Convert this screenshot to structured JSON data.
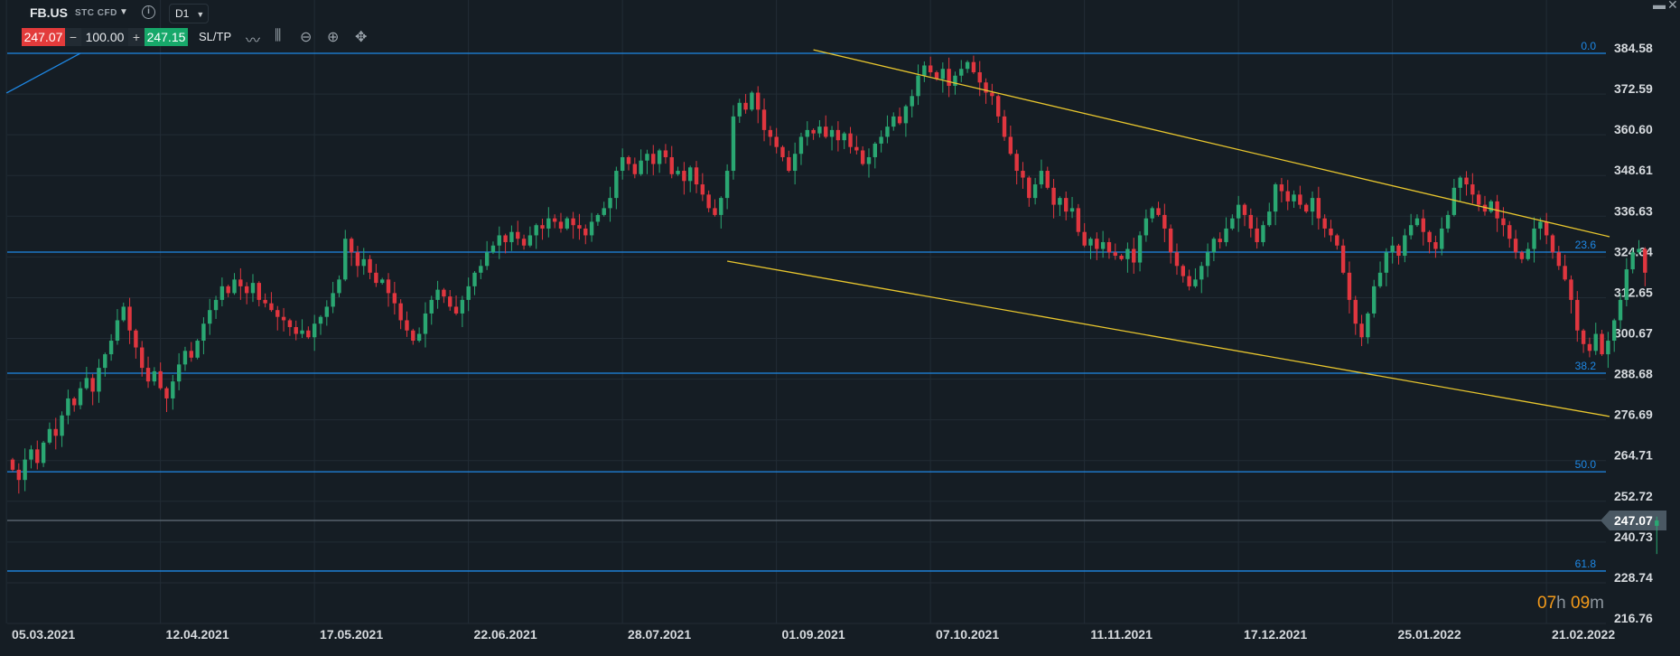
{
  "header": {
    "symbol": "FB.US",
    "type": "STC CFD",
    "timeframe": "D1",
    "sell_price": "247.07",
    "quantity": "100.00",
    "buy_price": "247.15",
    "sltp_label": "SL/TP",
    "minus": "−",
    "plus": "+"
  },
  "timer": {
    "hours": "07",
    "h": "h",
    "minutes": "09",
    "m": "m"
  },
  "colors": {
    "up": "#2aa772",
    "down": "#e0363f",
    "fib": "#1e88e5",
    "trend": "#e8c62e",
    "bg": "#151d24",
    "grid": "#222c35"
  },
  "chart_data": {
    "type": "candlestick",
    "title": "FB.US D1",
    "price_ticks": [
      "384.58",
      "372.59",
      "360.60",
      "348.61",
      "336.63",
      "324.64",
      "312.65",
      "300.67",
      "288.68",
      "276.69",
      "264.71",
      "252.72",
      "240.73",
      "228.74",
      "216.76"
    ],
    "date_ticks": [
      {
        "label": "05.03.2021",
        "index": 5
      },
      {
        "label": "12.04.2021",
        "index": 30
      },
      {
        "label": "17.05.2021",
        "index": 55
      },
      {
        "label": "22.06.2021",
        "index": 80
      },
      {
        "label": "28.07.2021",
        "index": 105
      },
      {
        "label": "01.09.2021",
        "index": 130
      },
      {
        "label": "07.10.2021",
        "index": 155
      },
      {
        "label": "11.11.2021",
        "index": 180
      },
      {
        "label": "17.12.2021",
        "index": 205
      },
      {
        "label": "25.01.2022",
        "index": 230
      },
      {
        "label": "21.02.2022",
        "index": 255
      }
    ],
    "ylim": [
      216.76,
      384.58
    ],
    "closes": [
      262,
      259,
      265,
      268,
      264,
      270,
      274,
      272,
      278,
      283,
      281,
      286,
      289,
      285,
      292,
      296,
      300,
      306,
      310,
      303,
      298,
      292,
      288,
      291,
      286,
      283,
      288,
      293,
      297,
      295,
      300,
      305,
      309,
      312,
      316,
      314,
      318,
      316,
      314,
      317,
      312,
      311,
      309,
      307,
      306,
      304,
      302,
      303,
      301,
      305,
      307,
      310,
      314,
      318,
      330,
      326,
      322,
      324,
      320,
      317,
      318,
      314,
      311,
      306,
      303,
      300,
      302,
      308,
      312,
      315,
      313,
      310,
      308,
      312,
      316,
      320,
      322,
      326,
      328,
      331,
      329,
      332,
      330,
      328,
      331,
      334,
      333,
      336,
      335,
      333,
      336,
      334,
      333,
      331,
      335,
      337,
      339,
      342,
      350,
      354,
      352,
      349,
      353,
      355,
      352,
      356,
      354,
      349,
      350,
      347,
      351,
      346,
      343,
      339,
      337,
      342,
      350,
      366,
      370,
      368,
      373,
      368,
      362,
      360,
      357,
      354,
      350,
      355,
      360,
      362,
      361,
      363,
      360,
      362,
      359,
      361,
      357,
      356,
      352,
      354,
      358,
      360,
      363,
      366,
      364,
      369,
      372,
      378,
      381,
      379,
      377,
      380,
      375,
      378,
      380,
      382,
      379,
      376,
      373,
      372,
      366,
      360,
      355,
      350,
      348,
      342,
      346,
      350,
      345,
      340,
      342,
      338,
      339,
      332,
      328,
      330,
      327,
      329,
      326,
      325,
      324,
      327,
      323,
      331,
      336,
      339,
      337,
      333,
      326,
      322,
      319,
      316,
      318,
      322,
      326,
      330,
      329,
      333,
      336,
      340,
      337,
      333,
      329,
      334,
      338,
      346,
      344,
      341,
      343,
      340,
      338,
      342,
      336,
      333,
      331,
      328,
      320,
      312,
      305,
      301,
      308,
      316,
      320,
      326,
      328,
      325,
      331,
      334,
      336,
      332,
      329,
      327,
      333,
      337,
      345,
      348,
      346,
      343,
      340,
      338,
      341,
      336,
      334,
      330,
      326,
      324,
      327,
      333,
      335,
      331,
      326,
      322,
      318,
      312,
      303,
      299,
      297,
      302,
      296,
      300,
      306,
      312,
      321,
      326,
      327,
      320
    ],
    "first_open": 265,
    "current_candle": {
      "open": 245.5,
      "high": 248.2,
      "low": 237.2,
      "close": 247.07
    },
    "current_price": "247.07",
    "fib_levels": [
      {
        "label": "0.0",
        "price": 384.58
      },
      {
        "label": "23.6",
        "price": 326.07
      },
      {
        "label": "38.2",
        "price": 290.43
      },
      {
        "label": "50.0",
        "price": 261.4
      },
      {
        "label": "61.8",
        "price": 232.2
      }
    ],
    "trendlines": [
      {
        "color": "trend",
        "from": [
          130,
          385.6
        ],
        "to": [
          260,
          330.6
        ]
      },
      {
        "color": "trend",
        "from": [
          116,
          323.4
        ],
        "to": [
          260,
          277.7
        ]
      },
      {
        "color": "fib",
        "from": [
          -1,
          372.9
        ],
        "to": [
          11,
          384.6
        ]
      }
    ]
  }
}
